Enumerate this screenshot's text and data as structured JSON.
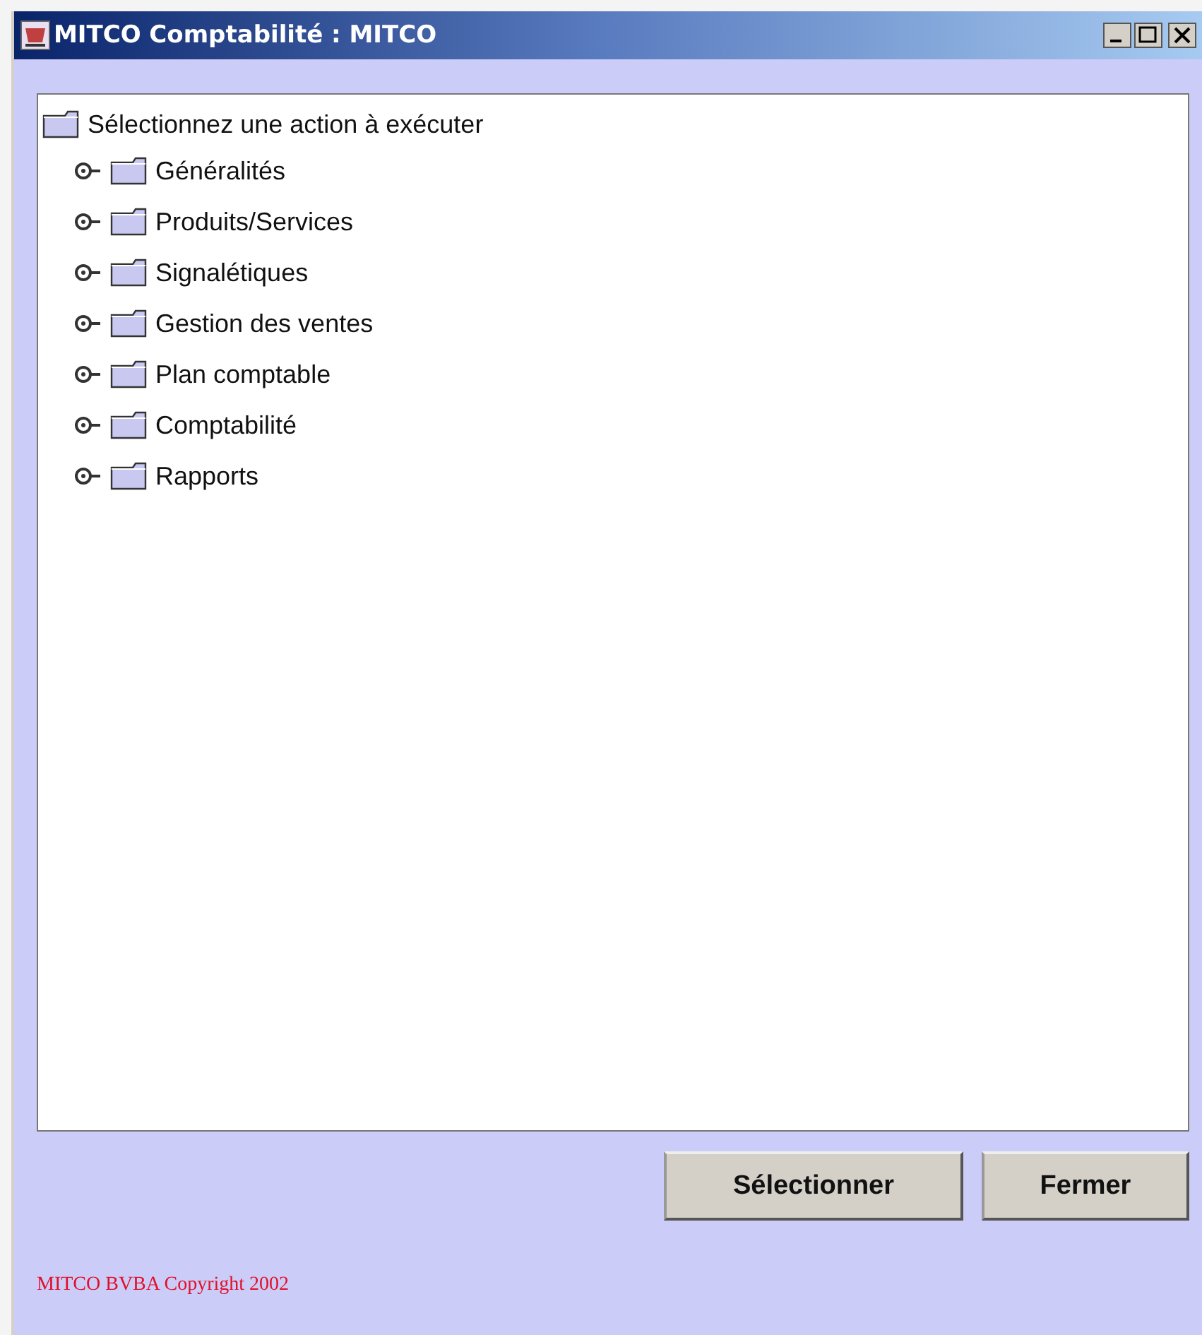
{
  "window": {
    "title": "MITCO Comptabilité : MITCO"
  },
  "tree": {
    "label": "Sélectionnez une action à exécuter",
    "children": [
      {
        "label": "Généralités",
        "expanded": false
      },
      {
        "label": "Produits/Services",
        "expanded": false
      },
      {
        "label": "Signalétiques",
        "expanded": false
      },
      {
        "label": "Gestion des ventes",
        "expanded": false
      },
      {
        "label": "Plan comptable",
        "expanded": false
      },
      {
        "label": "Comptabilité",
        "expanded": false
      },
      {
        "label": "Rapports",
        "expanded": false
      }
    ]
  },
  "buttons": [
    "Sélectionner",
    "Fermer"
  ],
  "footer": "MITCO BVBA Copyright 2002"
}
